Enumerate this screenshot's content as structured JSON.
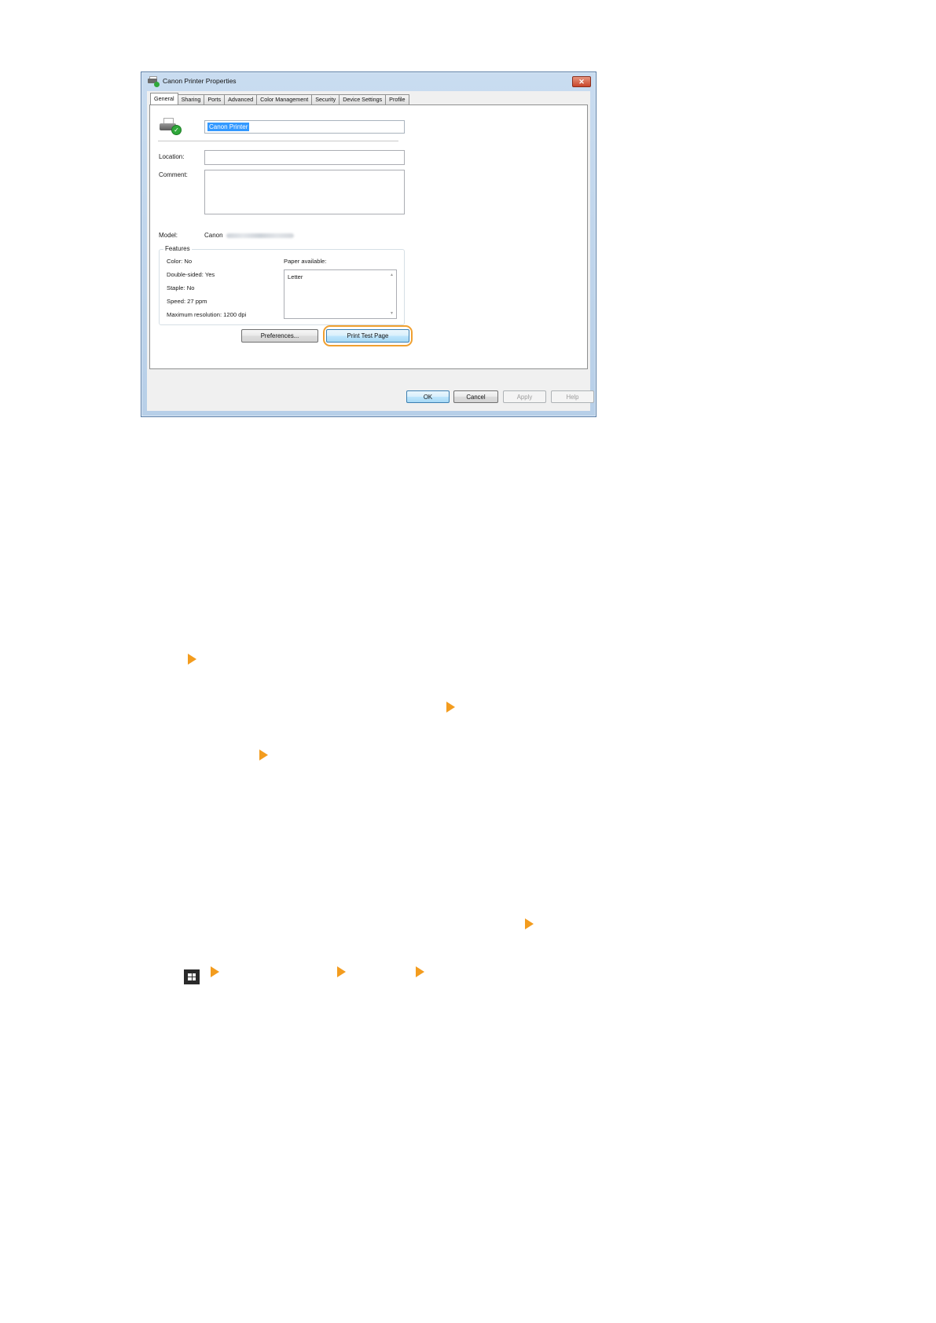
{
  "dialog": {
    "title": "Canon Printer Properties",
    "close_glyph": "✕",
    "tabs": [
      {
        "label": "General",
        "active": true
      },
      {
        "label": "Sharing"
      },
      {
        "label": "Ports"
      },
      {
        "label": "Advanced"
      },
      {
        "label": "Color Management"
      },
      {
        "label": "Security"
      },
      {
        "label": "Device Settings"
      },
      {
        "label": "Profile"
      }
    ],
    "general": {
      "printer_name": "Canon Printer",
      "location_label": "Location:",
      "location_value": "",
      "comment_label": "Comment:",
      "comment_value": "",
      "model_label": "Model:",
      "model_value": "Canon",
      "features_label": "Features",
      "features": {
        "color": "Color: No",
        "double_sided": "Double-sided: Yes",
        "staple": "Staple: No",
        "speed": "Speed: 27 ppm",
        "max_resolution": "Maximum resolution: 1200 dpi"
      },
      "paper_available_label": "Paper available:",
      "paper_options": [
        "Letter"
      ],
      "preferences_button": "Preferences...",
      "print_test_page_button": "Print Test Page"
    },
    "footer": {
      "ok": "OK",
      "cancel": "Cancel",
      "apply": "Apply",
      "help": "Help"
    }
  },
  "accent_color": "#f39c1e",
  "icons": {
    "printer": "printer-with-check-icon",
    "arrow": "orange-arrow-icon",
    "windows": "windows-start-icon"
  }
}
